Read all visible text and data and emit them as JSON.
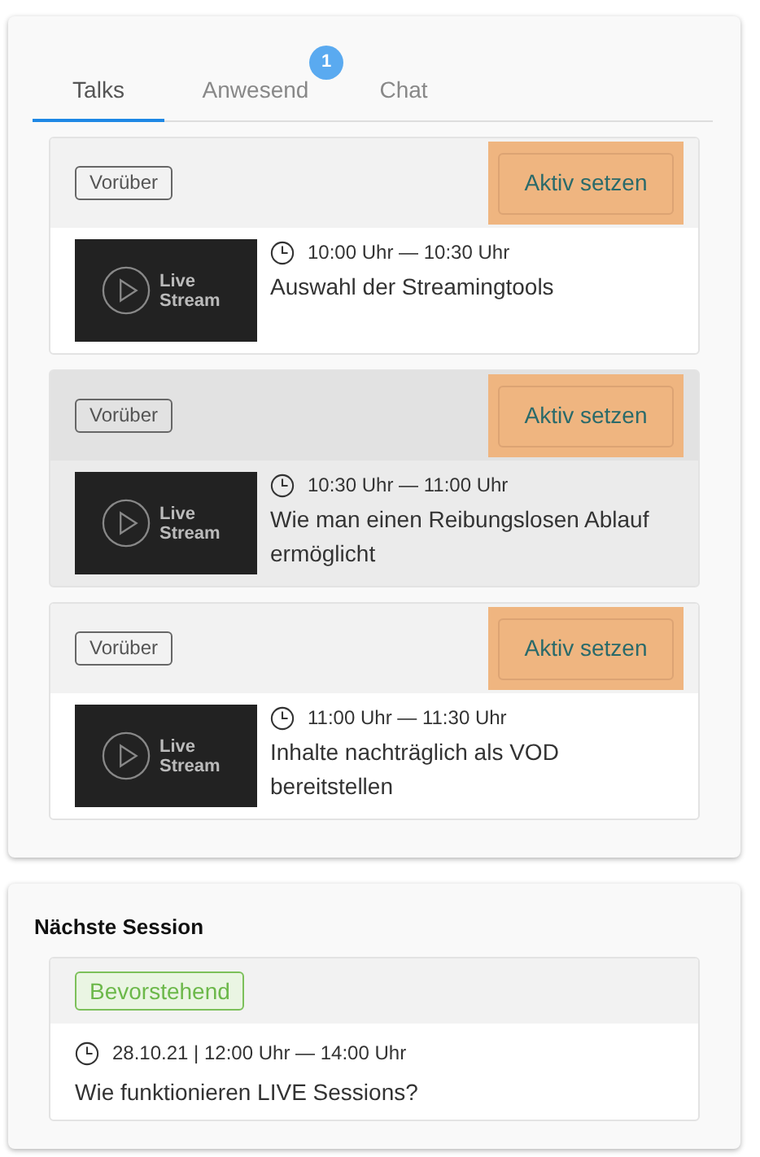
{
  "tabs": [
    {
      "label": "Talks",
      "selected": true
    },
    {
      "label": "Anwesend",
      "selected": false,
      "badge": "1"
    },
    {
      "label": "Chat",
      "selected": false
    }
  ],
  "talks": [
    {
      "status": "Vorüber",
      "action": "Aktiv setzen",
      "thumbnail_label": [
        "Live",
        "Stream"
      ],
      "time": "10:00 Uhr — 10:30 Uhr",
      "title": "Auswahl der Streamingtools",
      "highlighted": false
    },
    {
      "status": "Vorüber",
      "action": "Aktiv setzen",
      "thumbnail_label": [
        "Live",
        "Stream"
      ],
      "time": "10:30 Uhr — 11:00 Uhr",
      "title": "Wie man einen Reibungslosen Ablauf ermöglicht",
      "highlighted": true
    },
    {
      "status": "Vorüber",
      "action": "Aktiv setzen",
      "thumbnail_label": [
        "Live",
        "Stream"
      ],
      "time": "11:00 Uhr — 11:30 Uhr",
      "title": "Inhalte nachträglich als VOD bereitstellen",
      "highlighted": false
    }
  ],
  "next_session": {
    "heading": "Nächste Session",
    "status": "Bevorstehend",
    "time": "28.10.21 | 12:00 Uhr — 14:00 Uhr",
    "title": "Wie funktionieren LIVE Sessions?"
  }
}
